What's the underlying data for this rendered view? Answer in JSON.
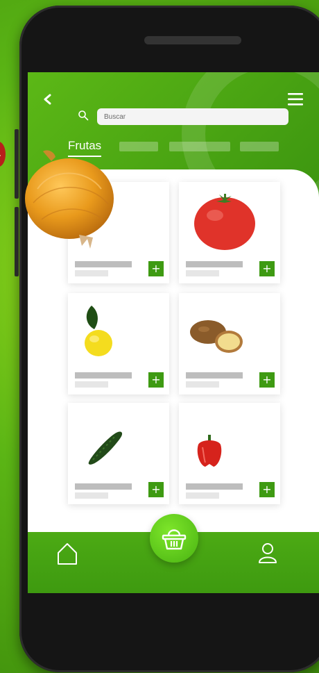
{
  "app": {
    "brand_color": "#4caa14",
    "accent_light": "#7ee62a",
    "add_button_color": "#3e9a12"
  },
  "header": {
    "back_icon": "chevron-left-icon",
    "menu_icon": "hamburger-menu-icon",
    "search": {
      "placeholder": "Buscar",
      "icon": "search-icon"
    }
  },
  "tabs": [
    {
      "label": "Frutas",
      "active": true
    }
  ],
  "products": [
    {
      "image": "onion",
      "add_label": "+"
    },
    {
      "image": "tomato",
      "add_label": "+"
    },
    {
      "image": "lemon",
      "add_label": "+"
    },
    {
      "image": "potato",
      "add_label": "+"
    },
    {
      "image": "cucumber",
      "add_label": "+"
    },
    {
      "image": "red-pepper",
      "add_label": "+"
    }
  ],
  "bottom_nav": {
    "home_icon": "home-icon",
    "basket_icon": "basket-icon",
    "profile_icon": "user-icon"
  }
}
